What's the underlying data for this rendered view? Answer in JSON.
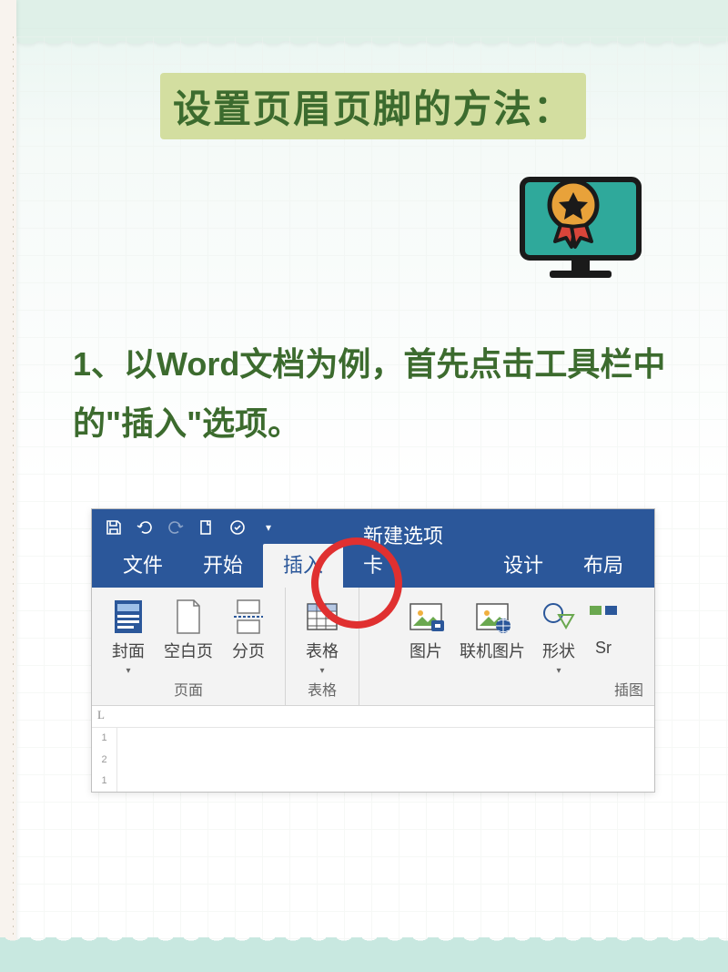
{
  "title": "设置页眉页脚的方法：",
  "step_text": "1、以Word文档为例，首先点击工具栏中的\"插入\"选项。",
  "icons": {
    "monitor": "award-monitor-icon",
    "save": "save-icon",
    "undo": "undo-icon",
    "redo": "redo-icon",
    "file": "file-icon",
    "check": "spellcheck-icon"
  },
  "word": {
    "tabs": {
      "file": "文件",
      "start": "开始",
      "insert": "插入",
      "custom": "新建选项卡",
      "design": "设计",
      "layout": "布局"
    },
    "active_tab": "insert",
    "ribbon": {
      "groups": [
        {
          "label": "页面",
          "items": [
            {
              "label": "封面",
              "icon": "cover-page-icon",
              "dropdown": true
            },
            {
              "label": "空白页",
              "icon": "blank-page-icon",
              "dropdown": false
            },
            {
              "label": "分页",
              "icon": "page-break-icon",
              "dropdown": false
            }
          ]
        },
        {
          "label": "表格",
          "items": [
            {
              "label": "表格",
              "icon": "table-icon",
              "dropdown": true
            }
          ]
        },
        {
          "label": "插图",
          "label_truncated": "插图",
          "items": [
            {
              "label": "图片",
              "icon": "picture-icon",
              "dropdown": false
            },
            {
              "label": "联机图片",
              "icon": "online-picture-icon",
              "dropdown": false
            },
            {
              "label": "形状",
              "icon": "shapes-icon",
              "dropdown": true
            },
            {
              "label": "Sr",
              "icon": "smartart-icon",
              "dropdown": false,
              "truncated": true
            }
          ]
        }
      ]
    },
    "vruler": [
      "1",
      "2",
      "1"
    ]
  }
}
